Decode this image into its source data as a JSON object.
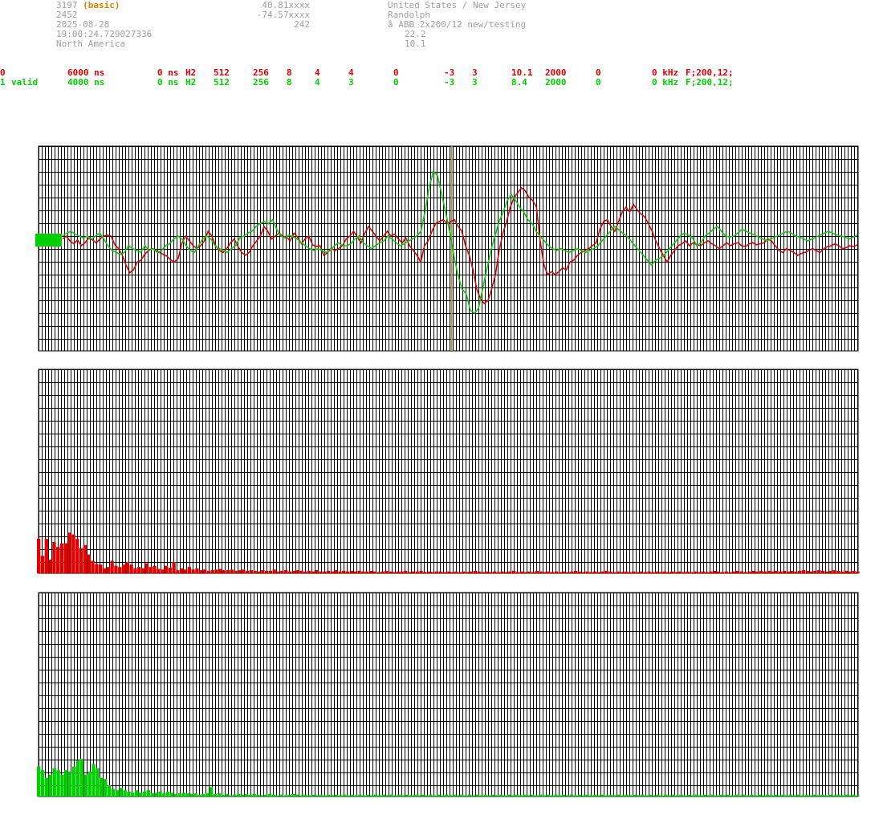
{
  "header": {
    "station_id": "3197",
    "station_type": "(basic)",
    "number": "2452",
    "date": "2025-08-28",
    "time": "19:00:24.729027336",
    "region": "North America",
    "latitude": "40.81xxxx",
    "longitude": "-74.57xxxx",
    "altitude": "242",
    "country": "United States / New Jersey",
    "city": "Randolph",
    "antenna": "â ABB 2x200/12 new/testing",
    "value_a": "22.2",
    "value_b": "10.1"
  },
  "channels": [
    {
      "id": "0",
      "status": "",
      "time": "6000 ns",
      "offset": "0 ns",
      "mode": "H2",
      "p1": "512",
      "p2": "256",
      "p3": "8",
      "p4": "4",
      "p5": "4",
      "p6": "0",
      "p7": "-3",
      "p8": "3",
      "p9": "10.1",
      "p10": "2000",
      "p11": "0",
      "freq": "0 kHz",
      "filter": "F;200,12;",
      "color": "#e00000"
    },
    {
      "id": "1",
      "status": "valid",
      "time": "4000 ns",
      "offset": "0 ns",
      "mode": "H2",
      "p1": "512",
      "p2": "256",
      "p3": "8",
      "p4": "4",
      "p5": "3",
      "p6": "0",
      "p7": "-3",
      "p8": "3",
      "p9": "8.4",
      "p10": "2000",
      "p11": "0",
      "freq": "0 kHz",
      "filter": "F;200,12;",
      "color": "#00d000"
    }
  ],
  "chart_data": [
    {
      "type": "line",
      "name": "waveform",
      "x_range": [
        0,
        512
      ],
      "y_range": [
        -1,
        1
      ],
      "marker_x": 258,
      "grid": true,
      "series": [
        {
          "color": "#e00000",
          "values": [
            0.02,
            0.05,
            0.0,
            -0.03,
            0.01,
            -0.05,
            -0.02,
            0.03,
            0.01,
            -0.02,
            0.02,
            0.05,
            0.06,
            0.05,
            -0.04,
            -0.08,
            -0.15,
            -0.25,
            -0.33,
            -0.3,
            -0.22,
            -0.2,
            -0.14,
            -0.1,
            -0.08,
            -0.1,
            -0.12,
            -0.14,
            -0.16,
            -0.2,
            -0.22,
            -0.18,
            -0.02,
            0.05,
            0.0,
            -0.05,
            -0.08,
            -0.05,
            0.0,
            0.1,
            0.05,
            -0.05,
            -0.1,
            -0.12,
            -0.08,
            -0.02,
            0.02,
            -0.06,
            -0.12,
            -0.15,
            -0.12,
            -0.05,
            0.0,
            0.05,
            0.15,
            0.1,
            0.02,
            0.05,
            0.08,
            0.05,
            0.04,
            0.0,
            0.08,
            0.04,
            -0.03,
            0.02,
            0.05,
            -0.04,
            -0.06,
            -0.05,
            -0.15,
            -0.12,
            -0.08,
            -0.1,
            -0.08,
            -0.05,
            0.02,
            0.05,
            0.1,
            0.04,
            -0.02,
            0.08,
            0.15,
            0.1,
            0.05,
            0.0,
            0.05,
            0.1,
            0.05,
            0.07,
            0.02,
            -0.02,
            0.03,
            -0.05,
            -0.1,
            -0.15,
            -0.22,
            -0.05,
            0.0,
            0.1,
            0.18,
            0.2,
            0.22,
            0.18,
            0.2,
            0.22,
            0.15,
            0.1,
            -0.05,
            -0.15,
            -0.3,
            -0.5,
            -0.6,
            -0.65,
            -0.62,
            -0.5,
            -0.35,
            -0.1,
            0.08,
            0.2,
            0.35,
            0.45,
            0.5,
            0.55,
            0.52,
            0.45,
            0.42,
            0.35,
            0.0,
            -0.25,
            -0.35,
            -0.32,
            -0.35,
            -0.32,
            -0.28,
            -0.3,
            -0.22,
            -0.2,
            -0.15,
            -0.12,
            -0.1,
            -0.08,
            -0.05,
            -0.02,
            0.12,
            0.2,
            0.22,
            0.15,
            0.1,
            0.2,
            0.3,
            0.35,
            0.3,
            0.38,
            0.32,
            0.28,
            0.25,
            0.18,
            0.1,
            0.0,
            -0.08,
            -0.15,
            -0.22,
            -0.15,
            -0.1,
            -0.05,
            -0.03,
            0.0,
            -0.05,
            -0.02,
            -0.04,
            -0.05,
            -0.02,
            0.0,
            -0.03,
            -0.05,
            -0.08,
            -0.05,
            -0.02,
            -0.05,
            -0.03,
            -0.02,
            -0.05,
            -0.06,
            -0.03,
            -0.02,
            -0.04,
            -0.03,
            -0.02,
            0.02,
            0.0,
            -0.05,
            -0.1,
            -0.12,
            -0.08,
            -0.1,
            -0.12,
            -0.15,
            -0.13,
            -0.12,
            -0.1,
            -0.08,
            -0.1,
            -0.12,
            -0.08,
            -0.06,
            -0.05,
            -0.03,
            -0.05,
            -0.08,
            -0.07,
            -0.05,
            -0.06,
            -0.04
          ]
        },
        {
          "color": "#00d000",
          "values": [
            0.05,
            0.08,
            0.1,
            0.07,
            0.05,
            0.03,
            0.05,
            0.02,
            0.05,
            0.08,
            0.02,
            -0.05,
            -0.1,
            -0.12,
            -0.14,
            -0.12,
            -0.05,
            -0.08,
            -0.1,
            -0.12,
            -0.05,
            -0.1,
            -0.08,
            -0.12,
            -0.1,
            -0.05,
            -0.03,
            0.02,
            0.05,
            0.02,
            -0.05,
            -0.1,
            -0.12,
            -0.05,
            0.02,
            0.05,
            0.02,
            -0.05,
            -0.08,
            -0.1,
            -0.12,
            -0.08,
            -0.05,
            0.03,
            0.05,
            0.08,
            0.1,
            0.15,
            0.18,
            0.2,
            0.18,
            0.22,
            0.12,
            0.05,
            0.03,
            0.06,
            0.04,
            0.02,
            -0.02,
            -0.05,
            -0.08,
            -0.1,
            -0.08,
            -0.1,
            -0.12,
            -0.1,
            -0.05,
            -0.02,
            -0.05,
            -0.05,
            -0.03,
            0.02,
            0.05,
            -0.02,
            -0.05,
            -0.08,
            -0.05,
            -0.02,
            0.0,
            0.05,
            0.02,
            -0.02,
            -0.05,
            -0.03,
            0.0,
            0.02,
            0.05,
            0.1,
            0.3,
            0.55,
            0.72,
            0.68,
            0.5,
            0.3,
            0.1,
            -0.15,
            -0.35,
            -0.5,
            -0.55,
            -0.72,
            -0.75,
            -0.7,
            -0.5,
            -0.3,
            -0.1,
            0.05,
            0.2,
            0.3,
            0.42,
            0.48,
            0.42,
            0.35,
            0.3,
            0.22,
            0.18,
            0.1,
            0.05,
            0.0,
            -0.05,
            -0.08,
            -0.1,
            -0.08,
            -0.1,
            -0.12,
            -0.1,
            -0.08,
            -0.1,
            -0.12,
            -0.1,
            -0.08,
            -0.05,
            0.0,
            0.05,
            0.1,
            0.15,
            0.12,
            0.08,
            0.05,
            0.0,
            -0.05,
            -0.1,
            -0.15,
            -0.2,
            -0.25,
            -0.2,
            -0.18,
            -0.15,
            -0.1,
            -0.05,
            0.0,
            0.05,
            0.08,
            0.06,
            0.03,
            -0.05,
            -0.02,
            0.05,
            0.08,
            0.12,
            0.15,
            0.1,
            0.05,
            0.04,
            0.05,
            0.08,
            0.12,
            0.1,
            0.08,
            0.06,
            0.04,
            0.02,
            0.0,
            0.02,
            0.04,
            0.06,
            0.08,
            0.1,
            0.08,
            0.05,
            0.04,
            0.02,
            0.0,
            0.02,
            0.04,
            0.06,
            0.08,
            0.1,
            0.08,
            0.06,
            0.05,
            0.04,
            0.02,
            0.04,
            0.06
          ]
        }
      ]
    },
    {
      "type": "bar",
      "name": "spectrum-red",
      "y_range": [
        0,
        1
      ],
      "grid": true,
      "color": "#e00000",
      "values": [
        0.55,
        0.28,
        0.55,
        0.22,
        0.5,
        0.42,
        0.48,
        0.48,
        0.65,
        0.62,
        0.55,
        0.4,
        0.45,
        0.3,
        0.2,
        0.15,
        0.14,
        0.08,
        0.1,
        0.2,
        0.12,
        0.1,
        0.14,
        0.18,
        0.14,
        0.08,
        0.1,
        0.08,
        0.16,
        0.1,
        0.12,
        0.07,
        0.06,
        0.12,
        0.09,
        0.18,
        0.05,
        0.08,
        0.06,
        0.1,
        0.06,
        0.08,
        0.05,
        0.06,
        0.04,
        0.05,
        0.06,
        0.07,
        0.05,
        0.05,
        0.06,
        0.04,
        0.05,
        0.06,
        0.04,
        0.05,
        0.04,
        0.03,
        0.05,
        0.04,
        0.04,
        0.06,
        0.03,
        0.04,
        0.05,
        0.03,
        0.04,
        0.05,
        0.04,
        0.03,
        0.04,
        0.03,
        0.05,
        0.03,
        0.03,
        0.04,
        0.03,
        0.05,
        0.03,
        0.04,
        0.03,
        0.04,
        0.03,
        0.04,
        0.03,
        0.03,
        0.04,
        0.03,
        0.02,
        0.03,
        0.04,
        0.03,
        0.02,
        0.03,
        0.03,
        0.04,
        0.02,
        0.03,
        0.03,
        0.04,
        0.02,
        0.03,
        0.02,
        0.03,
        0.03,
        0.02,
        0.03,
        0.02,
        0.03,
        0.02,
        0.03,
        0.02,
        0.03,
        0.04,
        0.03,
        0.02,
        0.03,
        0.02,
        0.03,
        0.02,
        0.03,
        0.02,
        0.03,
        0.04,
        0.02,
        0.03,
        0.02,
        0.03,
        0.02,
        0.04,
        0.03,
        0.02,
        0.03,
        0.02,
        0.03,
        0.02,
        0.03,
        0.02,
        0.03,
        0.04,
        0.03,
        0.02,
        0.03,
        0.02,
        0.03,
        0.02,
        0.03,
        0.04,
        0.03,
        0.02,
        0.03,
        0.02,
        0.03,
        0.02,
        0.03,
        0.02,
        0.03,
        0.02,
        0.03,
        0.02,
        0.03,
        0.02,
        0.03,
        0.02,
        0.03,
        0.02,
        0.03,
        0.02,
        0.03,
        0.02,
        0.03,
        0.02,
        0.03,
        0.02,
        0.03,
        0.04,
        0.03,
        0.02,
        0.03,
        0.02,
        0.03,
        0.04,
        0.03,
        0.02,
        0.03,
        0.04,
        0.03,
        0.04,
        0.03,
        0.04,
        0.03,
        0.04,
        0.03,
        0.04,
        0.03,
        0.04,
        0.03,
        0.04,
        0.05,
        0.04,
        0.03,
        0.04,
        0.05,
        0.04,
        0.03,
        0.04,
        0.05,
        0.04,
        0.03,
        0.04,
        0.03,
        0.04,
        0.03
      ]
    },
    {
      "type": "bar",
      "name": "spectrum-green",
      "y_range": [
        0,
        1
      ],
      "grid": true,
      "color": "#00d000",
      "values": [
        0.48,
        0.42,
        0.3,
        0.35,
        0.45,
        0.42,
        0.35,
        0.42,
        0.4,
        0.48,
        0.58,
        0.6,
        0.35,
        0.4,
        0.52,
        0.45,
        0.3,
        0.28,
        0.18,
        0.12,
        0.1,
        0.14,
        0.1,
        0.08,
        0.06,
        0.1,
        0.06,
        0.08,
        0.1,
        0.05,
        0.06,
        0.08,
        0.05,
        0.08,
        0.06,
        0.04,
        0.05,
        0.06,
        0.05,
        0.04,
        0.05,
        0.03,
        0.04,
        0.05,
        0.15,
        0.04,
        0.05,
        0.03,
        0.04,
        0.02,
        0.03,
        0.04,
        0.03,
        0.04,
        0.03,
        0.04,
        0.03,
        0.02,
        0.03,
        0.04,
        0.03,
        0.02,
        0.03,
        0.02,
        0.03,
        0.04,
        0.03,
        0.02,
        0.03,
        0.02,
        0.03,
        0.02,
        0.03,
        0.02,
        0.03,
        0.02,
        0.03,
        0.02,
        0.03,
        0.02,
        0.03,
        0.02,
        0.03,
        0.02,
        0.03,
        0.02,
        0.03,
        0.02,
        0.03,
        0.02,
        0.03,
        0.02,
        0.03,
        0.02,
        0.03,
        0.02,
        0.03,
        0.02,
        0.03,
        0.02,
        0.03,
        0.02,
        0.03,
        0.02,
        0.03,
        0.02,
        0.03,
        0.02,
        0.03,
        0.02,
        0.03,
        0.02,
        0.03,
        0.02,
        0.03,
        0.02,
        0.03,
        0.02,
        0.03,
        0.02,
        0.03,
        0.02,
        0.03,
        0.02,
        0.03,
        0.02,
        0.03,
        0.02,
        0.03,
        0.02,
        0.03,
        0.02,
        0.03,
        0.02,
        0.03,
        0.02,
        0.03,
        0.02,
        0.03,
        0.02,
        0.03,
        0.02,
        0.03,
        0.02,
        0.03,
        0.02,
        0.03,
        0.02,
        0.03,
        0.02,
        0.03,
        0.02,
        0.03,
        0.02,
        0.03,
        0.02,
        0.03,
        0.02,
        0.03,
        0.02,
        0.03,
        0.02,
        0.03,
        0.02,
        0.03,
        0.02,
        0.03,
        0.02,
        0.03,
        0.02,
        0.03,
        0.02,
        0.03,
        0.02,
        0.03,
        0.02,
        0.03,
        0.02,
        0.03,
        0.02,
        0.03,
        0.02,
        0.03,
        0.02,
        0.03,
        0.02,
        0.03,
        0.02,
        0.03,
        0.02,
        0.03,
        0.02,
        0.03,
        0.02,
        0.03,
        0.02,
        0.03,
        0.02,
        0.03,
        0.02,
        0.03,
        0.02,
        0.03,
        0.02,
        0.03,
        0.02,
        0.03,
        0.02,
        0.03,
        0.02
      ]
    }
  ]
}
